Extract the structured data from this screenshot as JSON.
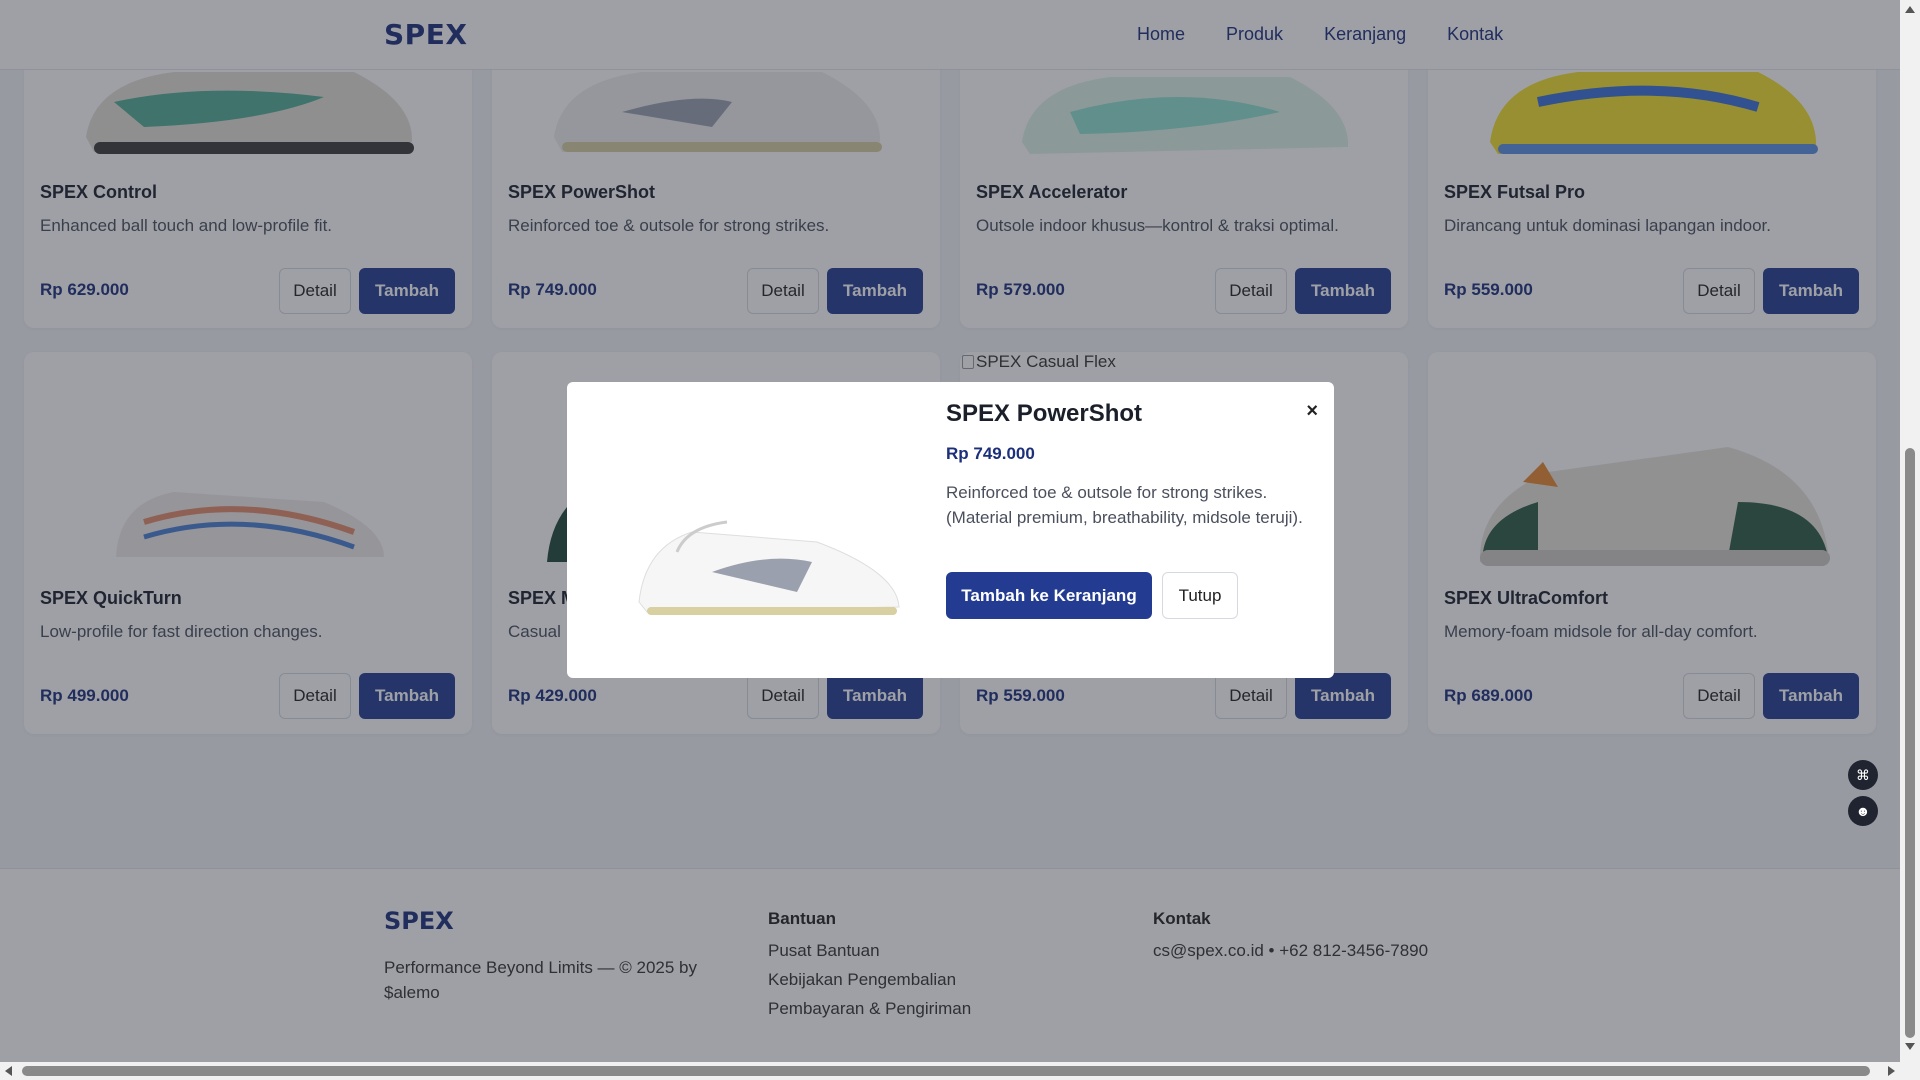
{
  "header": {
    "brand": "SPEX",
    "nav": [
      "Home",
      "Produk",
      "Keranjang",
      "Kontak"
    ]
  },
  "products": [
    {
      "name": "SPEX Control",
      "desc": "Enhanced ball touch and low-profile fit.",
      "price": "Rp 629.000",
      "color": "#3aa58a"
    },
    {
      "name": "SPEX PowerShot",
      "desc": "Reinforced toe & outsole for strong strikes.",
      "price": "Rp 749.000",
      "color": "#e8e8e8"
    },
    {
      "name": "SPEX Accelerator",
      "desc": "Outsole indoor khusus—kontrol & traksi optimal.",
      "price": "Rp 579.000",
      "color": "#8fe0d0"
    },
    {
      "name": "SPEX Futsal Pro",
      "desc": "Dirancang untuk dominasi lapangan indoor.",
      "price": "Rp 559.000",
      "color": "#f2e12a"
    },
    {
      "name": "SPEX QuickTurn",
      "desc": "Low-profile for fast direction changes.",
      "price": "Rp 499.000",
      "color": "#e38a6a"
    },
    {
      "name": "SPEX M",
      "desc": "Casual",
      "price": "Rp 429.000",
      "color": "#1f4a3a"
    },
    {
      "name": "",
      "desc": "",
      "price": "Rp 559.000",
      "color": "#ffffff"
    },
    {
      "name": "SPEX UltraComfort",
      "desc": "Memory-foam midsole for all-day comfort.",
      "price": "Rp 689.000",
      "color": "#2f5a44"
    }
  ],
  "buttons": {
    "detail": "Detail",
    "add": "Tambah"
  },
  "broken_image_alt": "SPEX Casual Flex",
  "modal": {
    "title": "SPEX PowerShot",
    "price": "Rp 749.000",
    "desc": "Reinforced toe & outsole for strong strikes. (Material premium, breathability, midsole teruji).",
    "close_symbol": "×",
    "add_to_cart": "Tambah ke Keranjang",
    "close": "Tutup"
  },
  "footer": {
    "brand": "SPEX",
    "tagline": "Performance Beyond Limits — © 2025 by $alemo",
    "help_title": "Bantuan",
    "help_links": [
      "Pusat Bantuan",
      "Kebijakan Pengembalian",
      "Pembayaran & Pengiriman"
    ],
    "contact_title": "Kontak",
    "contact_text": "cs@spex.co.id • +62 812-3456-7890"
  },
  "colors": {
    "primary": "#233c92",
    "brand": "#1c2f7a"
  }
}
